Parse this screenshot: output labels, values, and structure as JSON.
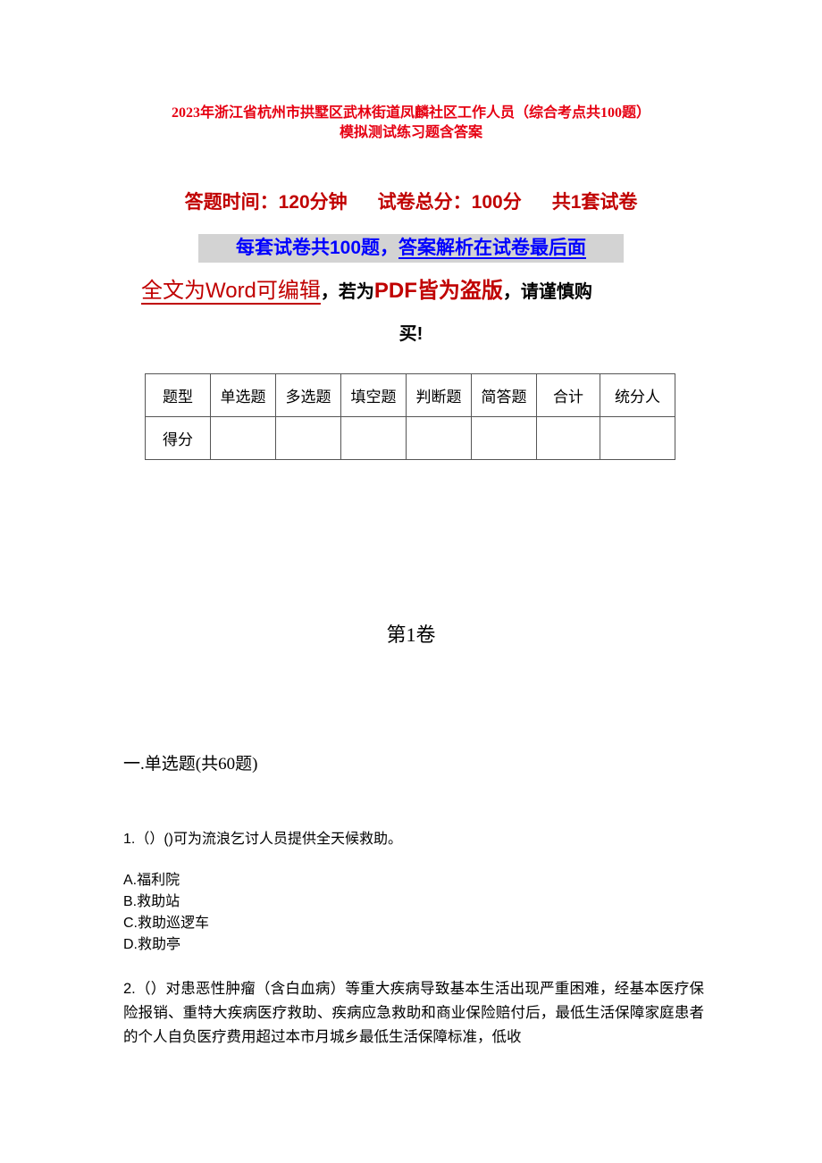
{
  "document": {
    "title_line1": "2023年浙江省杭州市拱墅区武林街道凤麟社区工作人员（综合考点共100题）",
    "title_line2": "模拟测试练习题含答案",
    "info": {
      "time": "答题时间：120分钟",
      "total_score": "试卷总分：100分",
      "sets": "共1套试卷"
    },
    "notice": {
      "part1": "每套试卷共100题，",
      "part2": "答案解析在试卷最后面"
    },
    "editable": {
      "word_part": "全文为Word可编辑",
      "comma1": "，",
      "if_part": "若为",
      "pdf_part": "PDF皆为盗版",
      "comma2": "，",
      "careful_part": "请谨慎购",
      "buy_part": "买!"
    },
    "score_table": {
      "header": [
        "题型",
        "单选题",
        "多选题",
        "填空题",
        "判断题",
        "简答题",
        "合计",
        "统分人"
      ],
      "row": [
        "得分",
        "",
        "",
        "",
        "",
        "",
        "",
        ""
      ]
    },
    "volume_title": "第1卷",
    "section_title": "一.单选题(共60题)",
    "questions": [
      {
        "text": "1.（）()可为流浪乞讨人员提供全天候救助。",
        "options": [
          "A.福利院",
          "B.救助站",
          "C.救助巡逻车",
          "D.救助亭"
        ]
      },
      {
        "text": "2.（）对患恶性肿瘤（含白血病）等重大疾病导致基本生活出现严重困难，经基本医疗保险报销、重特大疾病医疗救助、疾病应急救助和商业保险赔付后，最低生活保障家庭患者的个人自负医疗费用超过本市月城乡最低生活保障标准，低收"
      }
    ]
  }
}
